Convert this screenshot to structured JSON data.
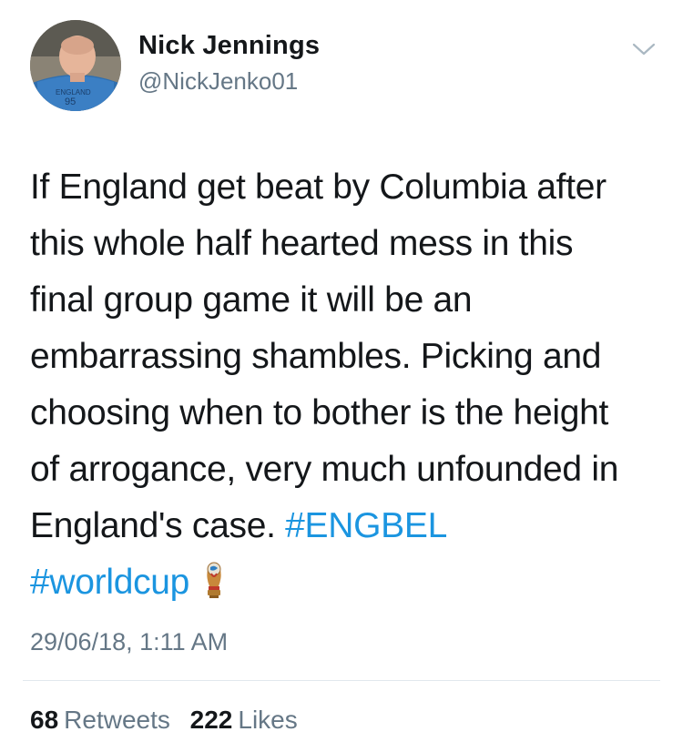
{
  "author": {
    "name": "Nick Jennings",
    "handle": "@NickJenko01"
  },
  "icons": {
    "menu": "chevron-down-icon",
    "emoji": "world-cup-trophy-icon",
    "avatar": "profile-photo"
  },
  "tweet": {
    "lines": [
      "If England get beat by Columbia after",
      "this whole half hearted mess in this",
      "final group game it will be an",
      "embarrassing shambles. Picking and",
      "choosing when to bother is the height",
      "of arrogance, very much unfounded in"
    ],
    "last_line_text": "England's case.",
    "hashtag_1": "#ENGBEL",
    "hashtag_2": "#worldcup"
  },
  "timestamp": "29/06/18, 1:11 AM",
  "stats": {
    "retweets_count": "68",
    "retweets_label": "Retweets",
    "likes_count": "222",
    "likes_label": "Likes"
  },
  "colors": {
    "link": "#1b95e0",
    "secondary_text": "#657786",
    "primary_text": "#14171a",
    "divider": "#e1e8ed"
  }
}
